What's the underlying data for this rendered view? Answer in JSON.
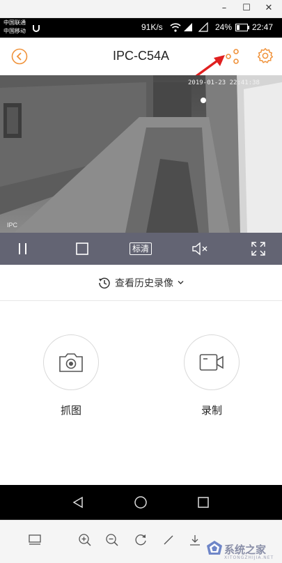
{
  "window": {
    "minimize": "–",
    "maximize": "☐",
    "close": "✕"
  },
  "status_bar": {
    "carrier_1": "中国联通",
    "carrier_2": "中国移动",
    "net_speed": "91K/s",
    "battery": "24%",
    "time": "22:47",
    "network_badges": [
      "4G",
      "2G"
    ]
  },
  "header": {
    "title": "IPC-C54A",
    "accent_color": "#f0923a",
    "icons": [
      "back-icon",
      "share-icon",
      "settings-icon"
    ]
  },
  "video": {
    "timestamp": "2019-01-23 22:41:38",
    "camera_tag": "IPC"
  },
  "controls": {
    "quality_label": "标清",
    "icons": [
      "pause-icon",
      "stop-icon",
      "mute-icon",
      "fullscreen-icon"
    ]
  },
  "history": {
    "label": "查看历史录像"
  },
  "actions": {
    "snapshot_label": "抓图",
    "record_label": "录制"
  },
  "watermark": {
    "text": "系统之家",
    "sub": "XITONGZHIJIA.NET"
  }
}
